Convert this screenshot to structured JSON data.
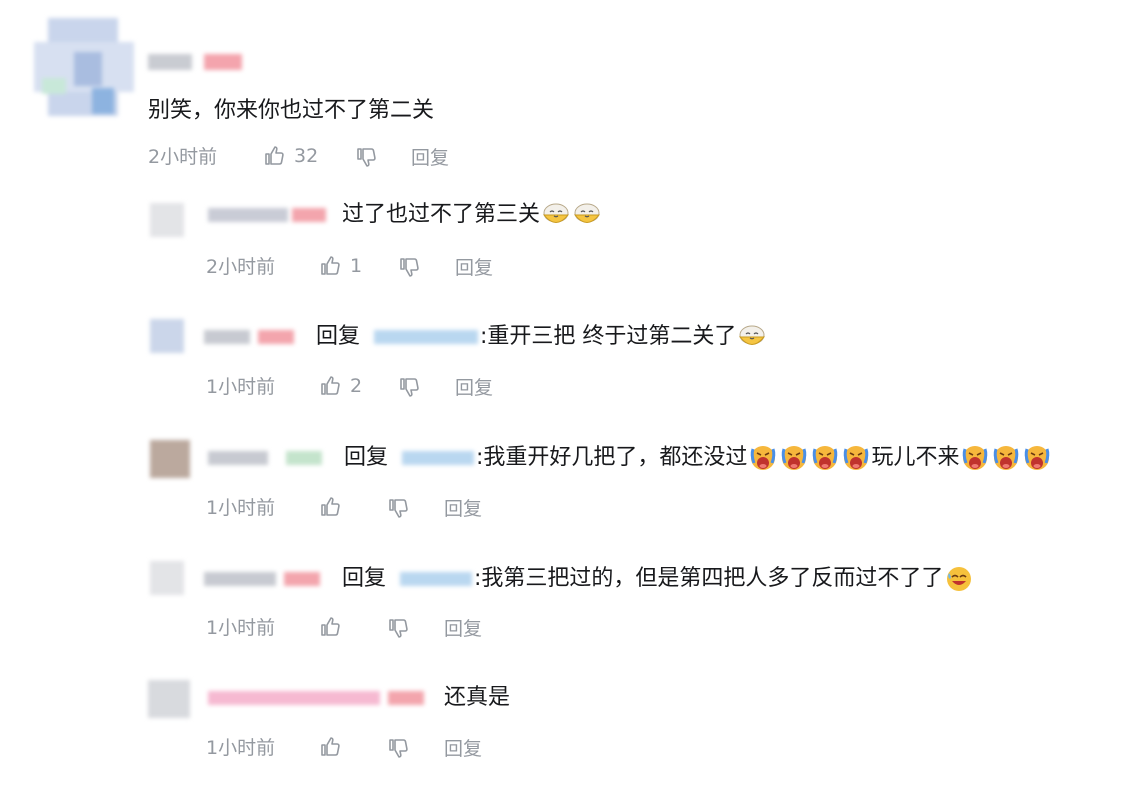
{
  "thread": {
    "root": {
      "content": "别笑，你来你也过不了第二关",
      "time": "2小时前",
      "likes": "32",
      "reply_label": "回复"
    },
    "replies": [
      {
        "content": "过了也过不了第三关",
        "emoji": "bowl-emoji",
        "emoji_count": 2,
        "time": "2小时前",
        "likes": "1",
        "reply_label": "回复"
      },
      {
        "prefix": "回复",
        "content": ":重开三把 终于过第二关了",
        "emoji": "bowl-emoji",
        "emoji_count": 1,
        "time": "1小时前",
        "likes": "2",
        "reply_label": "回复"
      },
      {
        "prefix": "回复",
        "content_a": ":我重开好几把了，都还没过",
        "content_b": "玩儿不来",
        "emoji": "crying-emoji",
        "time": "1小时前",
        "likes": "",
        "reply_label": "回复"
      },
      {
        "prefix": "回复",
        "content": ":我第三把过的，但是第四把人多了反而过不了了",
        "emoji": "sweat-smile-emoji",
        "emoji_count": 1,
        "time": "1小时前",
        "likes": "",
        "reply_label": "回复"
      },
      {
        "content": "还真是",
        "time": "1小时前",
        "likes": "",
        "reply_label": "回复"
      }
    ]
  },
  "colors": {
    "text": "#18191c",
    "meta": "#9499a0",
    "vip_pink": "#fb7299"
  }
}
